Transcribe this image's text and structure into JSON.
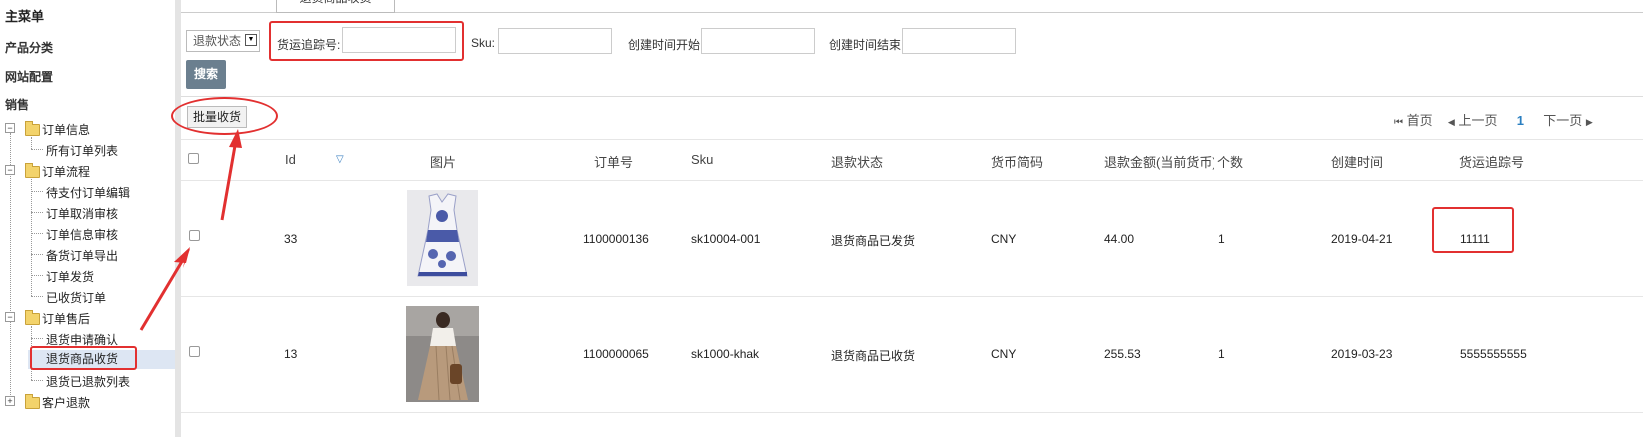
{
  "sidebar": {
    "title": "主菜单",
    "categories": [
      "产品分类",
      "网站配置",
      "销售"
    ],
    "groups": [
      {
        "label": "订单信息",
        "toggle": "−",
        "items": [
          "所有订单列表"
        ]
      },
      {
        "label": "订单流程",
        "toggle": "−",
        "items": [
          "待支付订单编辑",
          "订单取消审核",
          "订单信息审核",
          "备货订单导出",
          "订单发货",
          "已收货订单"
        ]
      },
      {
        "label": "订单售后",
        "toggle": "−",
        "items": [
          "退货申请确认",
          "退货商品收货",
          "退货已退款列表"
        ]
      },
      {
        "label": "客户退款",
        "toggle": "+",
        "items": []
      }
    ],
    "active_item": "退货商品收货"
  },
  "tab": {
    "label": "退货商品收货"
  },
  "filters": {
    "status_select": "退款状态",
    "tracking_label": "货运追踪号:",
    "sku_label": "Sku:",
    "created_start_label": "创建时间开始",
    "created_end_label": "创建时间结束",
    "search_button": "搜索"
  },
  "toolbar": {
    "batch_receive": "批量收货"
  },
  "pager": {
    "first": "首页",
    "prev": "上一页",
    "current": "1",
    "next": "下一页"
  },
  "table": {
    "columns": [
      "Id",
      "图片",
      "订单号",
      "Sku",
      "退款状态",
      "货币简码",
      "退款金额(当前货币)",
      "个数",
      "创建时间",
      "货运追踪号"
    ],
    "rows": [
      {
        "id": "33",
        "order_no": "1100000136",
        "sku": "sk10004-001",
        "status": "退货商品已发货",
        "currency": "CNY",
        "amount": "44.00",
        "qty": "1",
        "created": "2019-04-21",
        "tracking": "11111"
      },
      {
        "id": "13",
        "order_no": "1100000065",
        "sku": "sk1000-khak",
        "status": "退货商品已收货",
        "currency": "CNY",
        "amount": "255.53",
        "qty": "1",
        "created": "2019-03-23",
        "tracking": "5555555555"
      }
    ]
  },
  "colors": {
    "annotation": "#e23030",
    "search_button": "#6b7f8f",
    "active_item_bg": "#dde6f3",
    "page_active": "#2a7fc1"
  },
  "icons": [
    "folder-icon",
    "tree-toggle-icon",
    "dropdown-arrow-icon",
    "sort-desc-icon",
    "first-page-icon",
    "prev-page-icon",
    "next-page-icon"
  ]
}
